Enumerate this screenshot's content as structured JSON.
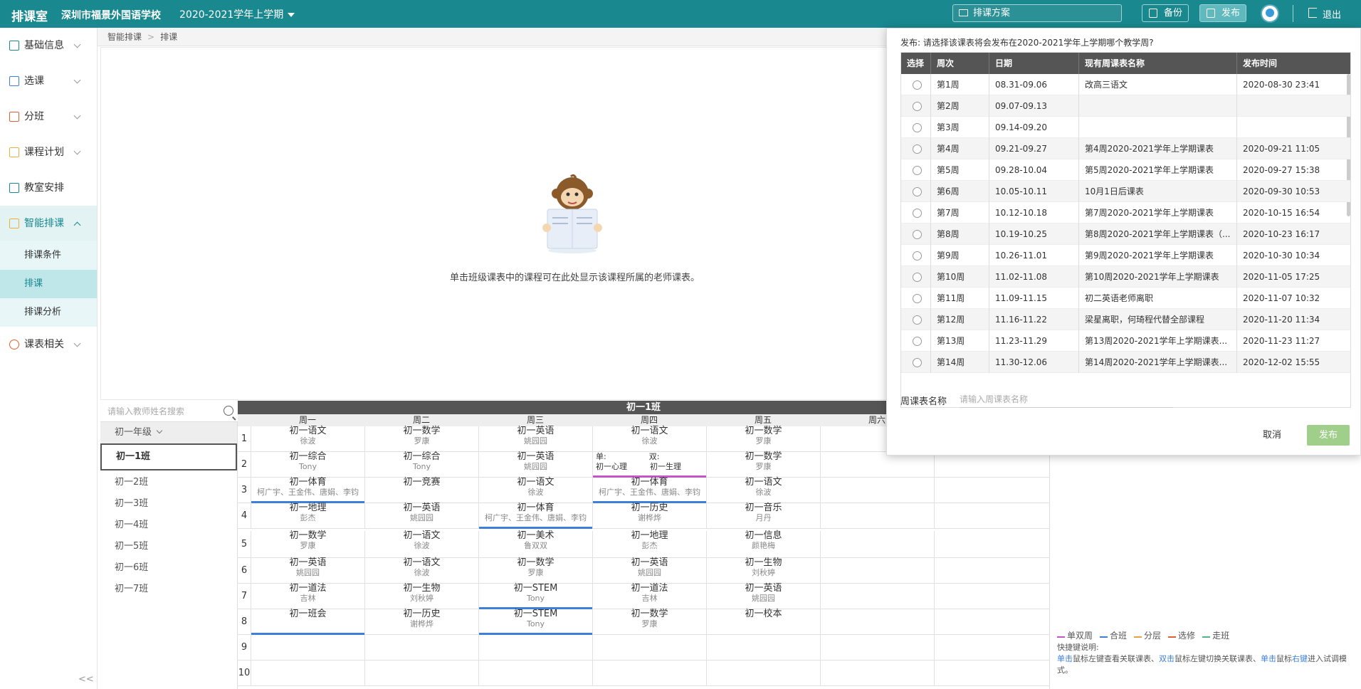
{
  "topbar": {
    "logo": "排课室",
    "school": "深圳市福景外国语学校",
    "term": "2020-2021学年上学期",
    "plan_placeholder": "排课方案",
    "backup": "备份",
    "publish": "发布",
    "logout": "退出"
  },
  "sidebar": {
    "items": [
      {
        "label": "基础信息"
      },
      {
        "label": "选课"
      },
      {
        "label": "分班"
      },
      {
        "label": "课程计划"
      },
      {
        "label": "教室安排"
      },
      {
        "label": "智能排课"
      },
      {
        "label": "课表相关"
      }
    ],
    "subitems": [
      "排课条件",
      "排课",
      "排课分析"
    ],
    "collapse": "<<"
  },
  "breadcrumb": {
    "root": "智能排课",
    "current": "排课"
  },
  "empty_hint": "单击班级课表中的课程可在此处显示该课程所属的老师课表。",
  "teacher_search_placeholder": "请输入教师姓名搜索",
  "grade": "初一年级",
  "classes": [
    "初一1班",
    "初一2班",
    "初一3班",
    "初一4班",
    "初一5班",
    "初一6班",
    "初一7班"
  ],
  "schedule": {
    "title": "初一1班",
    "days": [
      "周一",
      "周二",
      "周三",
      "周四",
      "周五",
      "周六"
    ],
    "rows": [
      {
        "n": "1",
        "cells": [
          {
            "c": "初一语文",
            "t": "徐波"
          },
          {
            "c": "初一数学",
            "t": "罗康"
          },
          {
            "c": "初一英语",
            "t": "姚园园"
          },
          {
            "c": "初一语文",
            "t": "徐波"
          },
          {
            "c": "初一数学",
            "t": "罗康"
          }
        ]
      },
      {
        "n": "2",
        "cells": [
          {
            "c": "初一综合",
            "t": "Tony"
          },
          {
            "c": "初一综合",
            "t": "Tony"
          },
          {
            "c": "初一英语",
            "t": "姚园园"
          },
          {
            "split": true,
            "a": "单:",
            "b": "双:",
            "c1": "初一心理",
            "c2": "初一生理"
          },
          {
            "c": "初一数学",
            "t": "罗康"
          }
        ]
      },
      {
        "n": "3",
        "cells": [
          {
            "c": "初一体育",
            "t": "柯广宇、王金伟、唐娟、李钧",
            "bar": "blue"
          },
          {
            "c": "初一竞赛",
            "t": ""
          },
          {
            "c": "初一语文",
            "t": "徐波"
          },
          {
            "c": "初一体育",
            "t": "柯广宇、王金伟、唐娟、李钧",
            "bar": "blue"
          },
          {
            "c": "初一语文",
            "t": "徐波"
          }
        ]
      },
      {
        "n": "4",
        "cells": [
          {
            "c": "初一地理",
            "t": "彭杰"
          },
          {
            "c": "初一英语",
            "t": "姚园园"
          },
          {
            "c": "初一体育",
            "t": "柯广宇、王金伟、唐娟、李钧",
            "bar": "blue"
          },
          {
            "c": "初一历史",
            "t": "谢桦烨"
          },
          {
            "c": "初一音乐",
            "t": "月丹"
          }
        ]
      },
      {
        "n": "5",
        "cells": [
          {
            "c": "初一数学",
            "t": "罗康"
          },
          {
            "c": "初一语文",
            "t": "徐波"
          },
          {
            "c": "初一美术",
            "t": "鲁双双"
          },
          {
            "c": "初一地理",
            "t": "彭杰"
          },
          {
            "c": "初一信息",
            "t": "颜艳梅"
          }
        ]
      },
      {
        "n": "6",
        "cells": [
          {
            "c": "初一英语",
            "t": "姚园园"
          },
          {
            "c": "初一语文",
            "t": "徐波"
          },
          {
            "c": "初一数学",
            "t": "罗康"
          },
          {
            "c": "初一英语",
            "t": "姚园园"
          },
          {
            "c": "初一生物",
            "t": "刘秋婷"
          }
        ]
      },
      {
        "n": "7",
        "cells": [
          {
            "c": "初一道法",
            "t": "吉林"
          },
          {
            "c": "初一生物",
            "t": "刘秋婷"
          },
          {
            "c": "初一STEM",
            "t": "Tony",
            "bar": "blue"
          },
          {
            "c": "初一道法",
            "t": "吉林"
          },
          {
            "c": "初一英语",
            "t": "姚园园"
          }
        ]
      },
      {
        "n": "8",
        "cells": [
          {
            "c": "初一班会",
            "t": "",
            "bar": "blue"
          },
          {
            "c": "初一历史",
            "t": "谢桦烨"
          },
          {
            "c": "初一STEM",
            "t": "Tony",
            "bar": "blue"
          },
          {
            "c": "初一数学",
            "t": "罗康"
          },
          {
            "c": "初一校本",
            "t": ""
          }
        ]
      },
      {
        "n": "9",
        "cells": []
      },
      {
        "n": "10",
        "cells": []
      }
    ]
  },
  "legend": [
    "单双周",
    "合班",
    "分层",
    "选修",
    "走班"
  ],
  "legend_colors": [
    "#c456c9",
    "#3d7fd9",
    "#e8a33d",
    "#e06030",
    "#4cb88a"
  ],
  "shortcut": {
    "title": "快捷键说明:",
    "single": "单击",
    "t1": "鼠标左键查看关联课表、",
    "double": "双击",
    "t2": "鼠标左键切换关联课表、",
    "single2": "单击",
    "t3": "鼠标",
    "right": "右键",
    "t4": "进入试调模式。"
  },
  "dialog": {
    "question": "发布: 请选择该课表将会发布在2020-2021学年上学期哪个教学周?",
    "headers": [
      "选择",
      "周次",
      "日期",
      "现有周课表名称",
      "发布时间"
    ],
    "rows": [
      {
        "week": "第1周",
        "date": "08.31-09.06",
        "name": "改高三语文",
        "time": "2020-08-30 23:41"
      },
      {
        "week": "第2周",
        "date": "09.07-09.13",
        "name": "",
        "time": ""
      },
      {
        "week": "第3周",
        "date": "09.14-09.20",
        "name": "",
        "time": ""
      },
      {
        "week": "第4周",
        "date": "09.21-09.27",
        "name": "第4周2020-2021学年上学期课表",
        "time": "2020-09-21 11:05"
      },
      {
        "week": "第5周",
        "date": "09.28-10.04",
        "name": "第5周2020-2021学年上学期课表",
        "time": "2020-09-27 15:38"
      },
      {
        "week": "第6周",
        "date": "10.05-10.11",
        "name": "10月1日后课表",
        "time": "2020-09-30 10:53"
      },
      {
        "week": "第7周",
        "date": "10.12-10.18",
        "name": "第7周2020-2021学年上学期课表",
        "time": "2020-10-15 16:54"
      },
      {
        "week": "第8周",
        "date": "10.19-10.25",
        "name": "第8周2020-2021学年上学期课表（...",
        "time": "2020-10-23 16:17"
      },
      {
        "week": "第9周",
        "date": "10.26-11.01",
        "name": "第9周2020-2021学年上学期课表",
        "time": "2020-10-30 10:34"
      },
      {
        "week": "第10周",
        "date": "11.02-11.08",
        "name": "第10周2020-2021学年上学期课表",
        "time": "2020-11-05 17:25"
      },
      {
        "week": "第11周",
        "date": "11.09-11.15",
        "name": "初二英语老师离职",
        "time": "2020-11-07 10:32"
      },
      {
        "week": "第12周",
        "date": "11.16-11.22",
        "name": "梁星离职，何琦程代替全部课程",
        "time": "2020-11-20 11:34"
      },
      {
        "week": "第13周",
        "date": "11.23-11.29",
        "name": "第13周2020-2021学年上学期课表...",
        "time": "2020-11-23 11:27"
      },
      {
        "week": "第14周",
        "date": "11.30-12.06",
        "name": "第14周2020-2021学年上学期课表...",
        "time": "2020-12-02 15:55"
      }
    ],
    "name_label": "周课表名称",
    "name_placeholder": "请输入周课表名称",
    "cancel": "取消",
    "publish": "发布"
  }
}
